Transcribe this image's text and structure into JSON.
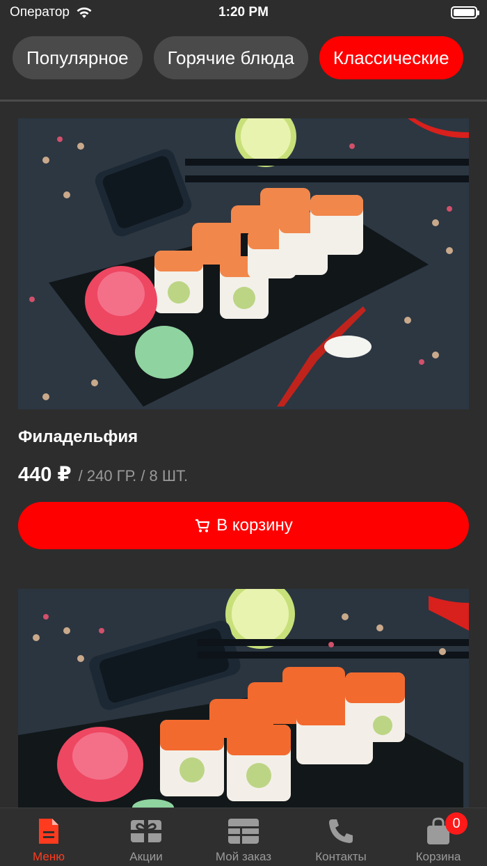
{
  "status": {
    "carrier": "Оператор",
    "time": "1:20 PM"
  },
  "tabs": [
    {
      "label": "Популярное",
      "active": false
    },
    {
      "label": "Горячие блюда",
      "active": false
    },
    {
      "label": "Классические",
      "active": true
    }
  ],
  "products": [
    {
      "name": "Филадельфия",
      "price": "440 ₽",
      "weight": "/ 240 ГР. / 8 ШТ.",
      "button": "В корзину"
    },
    {
      "name": "",
      "price": "",
      "weight": "",
      "button": ""
    }
  ],
  "nav": {
    "items": [
      {
        "label": "Меню",
        "icon": "document-icon",
        "active": true
      },
      {
        "label": "Акции",
        "icon": "gift-icon",
        "active": false
      },
      {
        "label": "Мой заказ",
        "icon": "grid-icon",
        "active": false
      },
      {
        "label": "Контакты",
        "icon": "phone-icon",
        "active": false
      },
      {
        "label": "Корзина",
        "icon": "bag-icon",
        "active": false
      }
    ],
    "cart_count": "0"
  },
  "colors": {
    "accent": "#ff0000",
    "background": "#2d2d2d",
    "tab": "#4a4a4a"
  }
}
